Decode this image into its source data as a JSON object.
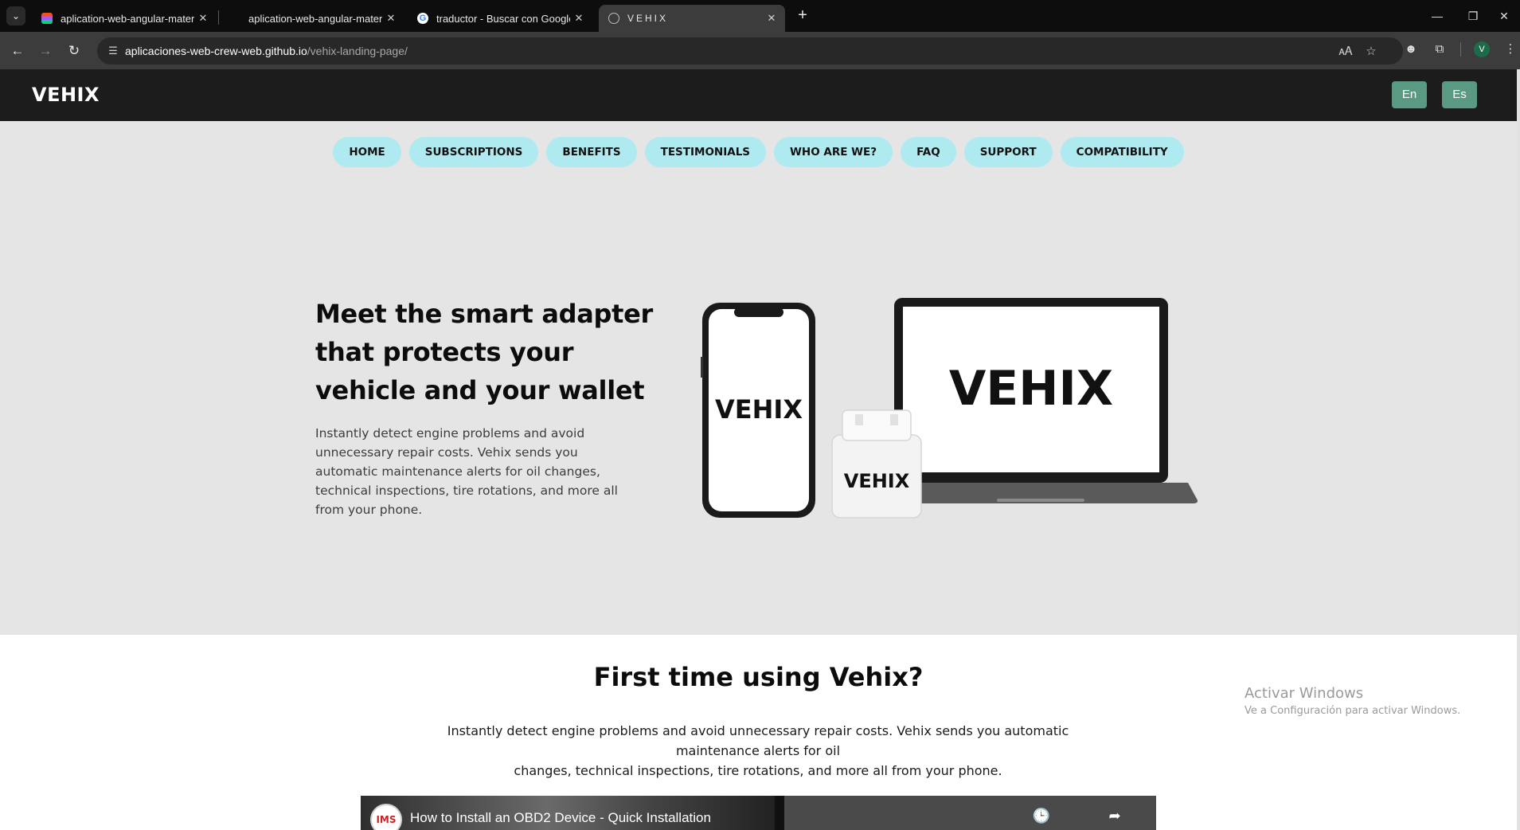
{
  "browser": {
    "tabs": [
      {
        "title": "aplication-web-angular-materi",
        "favicon": "figma-icon",
        "active": false
      },
      {
        "title": "aplication-web-angular-materi",
        "favicon": "none",
        "active": false
      },
      {
        "title": "traductor - Buscar con Google",
        "favicon": "google-icon",
        "active": false
      },
      {
        "title": "VEHIX",
        "favicon": "globe-icon",
        "active": true
      }
    ],
    "url_host": "aplicaciones-web-crew-web.github.io",
    "url_path": "/vehix-landing-page/",
    "profile_initial": "V"
  },
  "site": {
    "logo": "VEHIX",
    "lang_en": "En",
    "lang_es": "Es",
    "nav": [
      "HOME",
      "SUBSCRIPTIONS",
      "BENEFITS",
      "TESTIMONIALS",
      "WHO ARE WE?",
      "FAQ",
      "SUPPORT",
      "COMPATIBILITY"
    ]
  },
  "hero": {
    "title": "Meet the smart adapter that protects your vehicle and your wallet",
    "description": "Instantly detect engine problems and avoid unnecessary repair costs. Vehix sends you automatic maintenance alerts for oil changes, technical inspections, tire rotations, and more all from your phone.",
    "phone_label": "VEHIX",
    "adapter_label": "VEHIX",
    "laptop_label": "VEHIX"
  },
  "first_time": {
    "title": "First time using Vehix?",
    "description_line1": "Instantly detect engine problems and avoid unnecessary repair costs. Vehix sends you automatic maintenance alerts for oil",
    "description_line2": "changes, technical inspections, tire rotations, and more all from your phone."
  },
  "video": {
    "channel_logo_text": "IMS",
    "title": "How to Install an OBD2 Device - Quick Installation"
  },
  "os_watermark": {
    "line1": "Activar Windows",
    "line2": "Ve a Configuración para activar Windows."
  }
}
